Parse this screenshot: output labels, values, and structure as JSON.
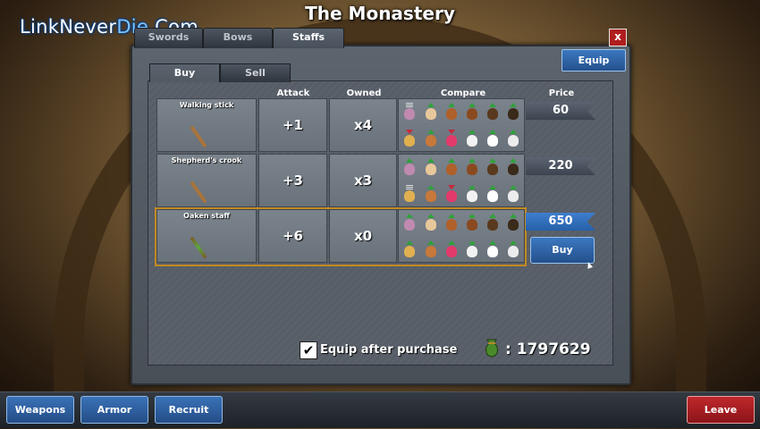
{
  "title": "The Monastery",
  "watermark": {
    "part1": "LinkNever",
    "part2": "Die",
    "part3": ".Com"
  },
  "weapon_tabs": [
    "Swords",
    "Bows",
    "Staffs"
  ],
  "close_label": "x",
  "equip_label": "Equip",
  "trade_tabs": [
    "Buy",
    "Sell"
  ],
  "columns": {
    "attack": "Attack",
    "owned": "Owned",
    "compare": "Compare",
    "price": "Price"
  },
  "items": [
    {
      "name": "Walking stick",
      "attack": "+1",
      "owned": "x4",
      "price": "60"
    },
    {
      "name": "Shepherd's crook",
      "attack": "+3",
      "owned": "x3",
      "price": "220"
    },
    {
      "name": "Oaken staff",
      "attack": "+6",
      "owned": "x0",
      "price": "650"
    }
  ],
  "buy_label": "Buy",
  "equip_after_purchase": {
    "checked": true,
    "check_glyph": "✔",
    "label": "Equip after purchase"
  },
  "gold": ": 1797629",
  "bottom_buttons": [
    "Weapons",
    "Armor",
    "Recruit"
  ],
  "leave_label": "Leave",
  "colors": {
    "accent": "#2f6ab0",
    "selected_outline": "#c28a22",
    "leave": "#b02024"
  }
}
